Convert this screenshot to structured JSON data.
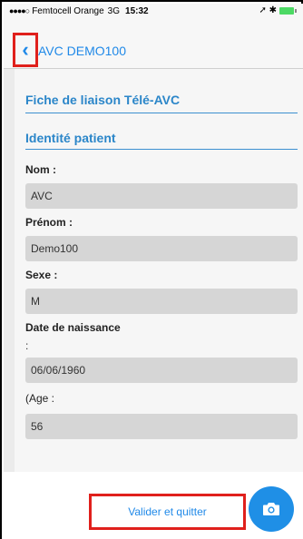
{
  "status_bar": {
    "signal": "●●●●○",
    "carrier": "Femtocell Orange",
    "network": "3G",
    "time": "15:32",
    "indicators": "➚ ✱"
  },
  "nav": {
    "back_icon": "‹",
    "title": "AVC DEMO100"
  },
  "form": {
    "title": "Fiche de liaison Télé-AVC",
    "section": "Identité patient",
    "nom_label": "Nom :",
    "nom_value": "AVC",
    "prenom_label": "Prénom :",
    "prenom_value": "Demo100",
    "sexe_label": "Sexe :",
    "sexe_value": "M",
    "dob_label": "Date de naissance",
    "dob_colon": ":",
    "dob_value": "06/06/1960",
    "age_label": "(Age :",
    "age_value": "56"
  },
  "actions": {
    "validate_label": "Valider et quitter",
    "camera_icon": "camera-icon"
  },
  "colors": {
    "accent": "#2089e8",
    "section_title": "#2b86c9",
    "highlight_box": "#e0201c",
    "camera_button": "#1f8fe6",
    "field_bg": "#d6d6d6"
  }
}
